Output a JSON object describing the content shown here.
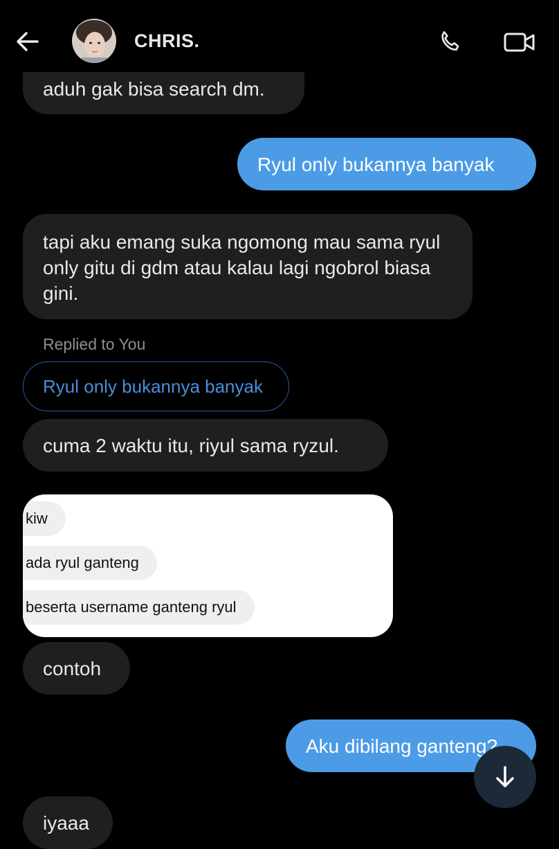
{
  "header": {
    "contact_name": "CHRIS.",
    "back_icon": "arrow-left-icon",
    "call_icon": "phone-icon",
    "video_icon": "video-camera-icon"
  },
  "messages": [
    {
      "direction": "incoming",
      "text": "aduh gak bisa search dm."
    },
    {
      "direction": "outgoing",
      "text": "Ryul only bukannya banyak"
    },
    {
      "direction": "incoming",
      "text": "tapi aku emang suka ngomong mau sama ryul only gitu di gdm atau kalau lagi ngobrol biasa gini."
    },
    {
      "direction": "incoming",
      "replied_label": "Replied to You",
      "quoted": "Ryul only bukannya banyak",
      "text": "cuma 2 waktu itu, riyul sama ryzul."
    },
    {
      "direction": "incoming",
      "type": "image",
      "image_lines": [
        "kiw",
        "ada ryul ganteng",
        "beserta username ganteng ryul"
      ]
    },
    {
      "direction": "incoming",
      "text": "contoh"
    },
    {
      "direction": "outgoing",
      "text": "Aku dibilang ganteng?"
    },
    {
      "direction": "incoming",
      "text": "iyaaa"
    }
  ],
  "scroll_button_icon": "arrow-down-icon",
  "colors": {
    "background": "#000000",
    "incoming_bubble": "#1f1f1f",
    "outgoing_bubble": "#4c9be6",
    "reply_border": "#2c5aa5",
    "reply_text": "#4a8ed8"
  }
}
